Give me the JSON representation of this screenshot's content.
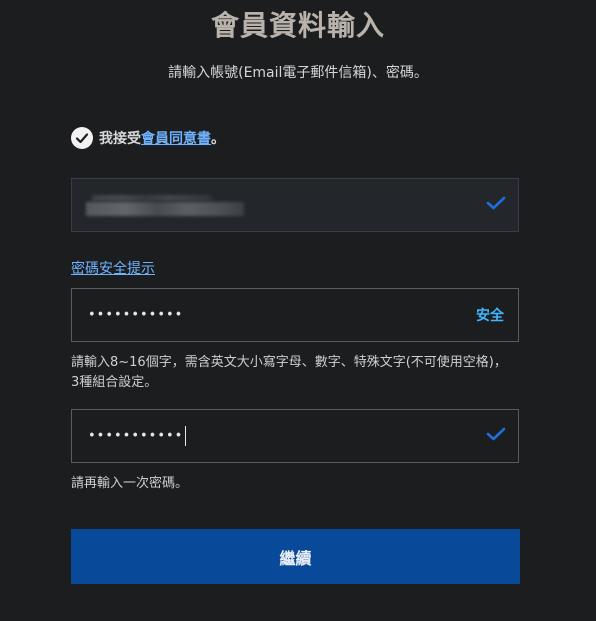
{
  "header": {
    "title": "會員資料輸入",
    "subtitle": "請輸入帳號(Email電子郵件信箱)、密碼。"
  },
  "agreement": {
    "prefix": "我接受",
    "link": "會員同意書",
    "suffix": "。",
    "checked": true
  },
  "account_field": {
    "value_redacted": true
  },
  "password": {
    "tips_link": "密碼安全提示",
    "masked_value": "•••••••••••",
    "strength_label": "安全",
    "help_text": "請輸入8~16個字，需含英文大小寫字母、數字、特殊文字(不可使用空格)，3種組合設定。"
  },
  "confirm_password": {
    "masked_value": "•••••••••••",
    "help_text": "請再輸入一次密碼。"
  },
  "actions": {
    "continue_label": "繼續"
  },
  "colors": {
    "background": "#1c1d1f",
    "accent_link": "#6fb3ff",
    "strength": "#3fb6ff",
    "check": "#1e6fd9",
    "primary_button": "#084a99"
  }
}
